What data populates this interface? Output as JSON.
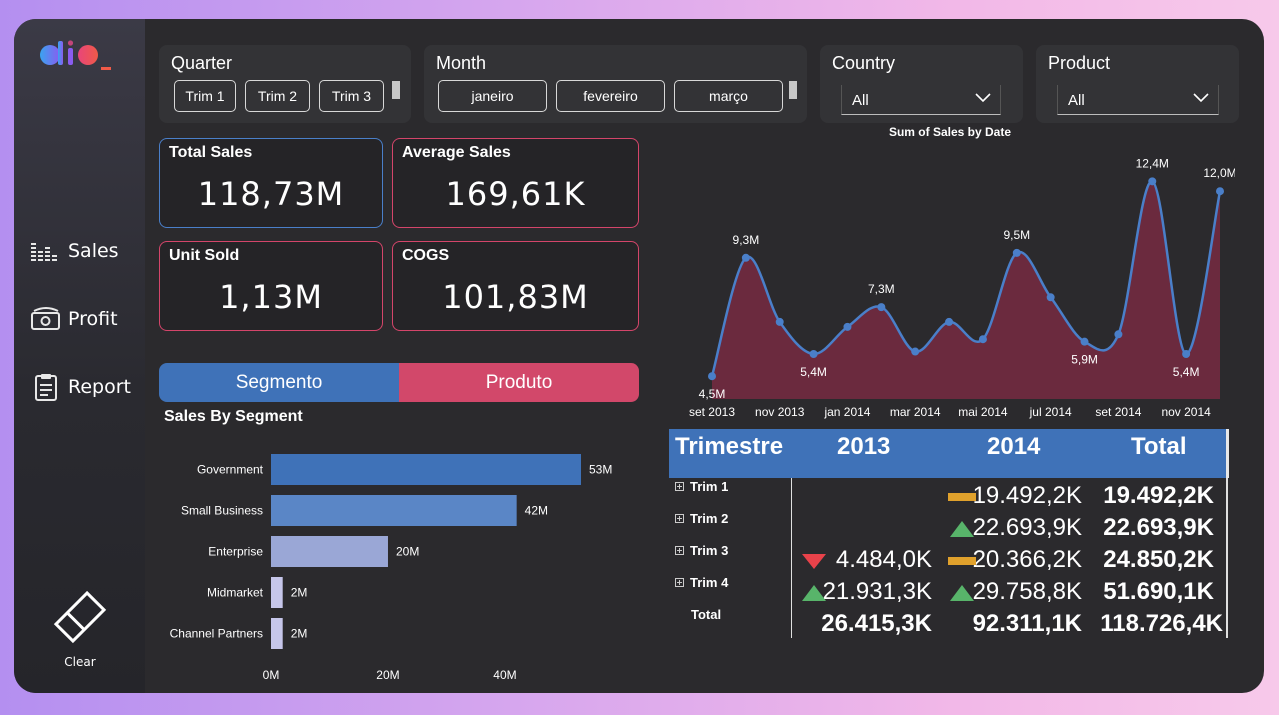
{
  "sidebar": {
    "nav": [
      {
        "label": "Sales",
        "icon": "sales-bars-icon"
      },
      {
        "label": "Profit",
        "icon": "money-icon"
      },
      {
        "label": "Report",
        "icon": "clipboard-icon"
      }
    ],
    "clear_label": "Clear"
  },
  "slicers": {
    "quarter": {
      "title": "Quarter",
      "options": [
        "Trim 1",
        "Trim 2",
        "Trim 3"
      ]
    },
    "month": {
      "title": "Month",
      "options": [
        "janeiro",
        "fevereiro",
        "março"
      ]
    },
    "country": {
      "title": "Country",
      "value": "All"
    },
    "product": {
      "title": "Product",
      "value": "All"
    }
  },
  "cards": {
    "total_sales": {
      "title": "Total Sales",
      "value": "118,73M"
    },
    "average_sales": {
      "title": "Average Sales",
      "value": "169,61K"
    },
    "unit_sold": {
      "title": "Unit Sold",
      "value": "1,13M"
    },
    "cogs": {
      "title": "COGS",
      "value": "101,83M"
    }
  },
  "toggle": {
    "left": "Segmento",
    "right": "Produto"
  },
  "colors": {
    "accent_blue": "#3f72b8",
    "accent_pink": "#d2486a",
    "area_fill": "#6b2a3e",
    "line": "#4a7fc9"
  },
  "chart_data": [
    {
      "type": "bar",
      "title": "Sales By Segment",
      "orientation": "horizontal",
      "categories": [
        "Government",
        "Small Business",
        "Enterprise",
        "Midmarket",
        "Channel Partners"
      ],
      "values": [
        53,
        42,
        20,
        2,
        2
      ],
      "value_labels": [
        "53M",
        "42M",
        "20M",
        "2M",
        "2M"
      ],
      "xticks": [
        "0M",
        "20M",
        "40M"
      ],
      "xlim": [
        0,
        60
      ],
      "bar_colors": [
        "#3f72b8",
        "#5a86c6",
        "#9aa7d6",
        "#c6c6ea",
        "#c6c6ea"
      ]
    },
    {
      "type": "area",
      "title": "Sum of Sales by Date",
      "x": [
        "set 2013",
        "out 2013",
        "nov 2013",
        "dez 2013",
        "jan 2014",
        "fev 2014",
        "mar 2014",
        "abr 2014",
        "mai 2014",
        "jun 2014",
        "jul 2014",
        "ago 2014",
        "set 2014",
        "out 2014",
        "nov 2014",
        "dez 2014"
      ],
      "values": [
        4.5,
        9.3,
        6.7,
        5.4,
        6.5,
        7.3,
        5.5,
        6.7,
        6.0,
        9.5,
        7.7,
        5.9,
        6.2,
        12.4,
        5.4,
        12.0
      ],
      "point_labels": [
        {
          "i": 0,
          "text": "4,5M"
        },
        {
          "i": 1,
          "text": "9,3M"
        },
        {
          "i": 3,
          "text": "5,4M"
        },
        {
          "i": 5,
          "text": "7,3M"
        },
        {
          "i": 9,
          "text": "9,5M"
        },
        {
          "i": 11,
          "text": "5,9M"
        },
        {
          "i": 13,
          "text": "12,4M"
        },
        {
          "i": 14,
          "text": "5,4M"
        },
        {
          "i": 15,
          "text": "12,0M"
        }
      ],
      "xticks": [
        "set 2013",
        "nov 2013",
        "jan 2014",
        "mar 2014",
        "mai 2014",
        "jul 2014",
        "set 2014",
        "nov 2014"
      ],
      "ylim": [
        4,
        13
      ]
    }
  ],
  "matrix": {
    "headers": [
      "Trimestre",
      "2013",
      "2014",
      "Total"
    ],
    "rows": [
      {
        "label": "Trim 1",
        "y2013": "",
        "ind2013": "",
        "y2014": "19.492,2K",
        "ind2014": "flat",
        "total": "19.492,2K"
      },
      {
        "label": "Trim 2",
        "y2013": "",
        "ind2013": "",
        "y2014": "22.693,9K",
        "ind2014": "up",
        "total": "22.693,9K"
      },
      {
        "label": "Trim 3",
        "y2013": "4.484,0K",
        "ind2013": "down",
        "y2014": "20.366,2K",
        "ind2014": "flat",
        "total": "24.850,2K"
      },
      {
        "label": "Trim 4",
        "y2013": "21.931,3K",
        "ind2013": "up",
        "y2014": "29.758,8K",
        "ind2014": "up",
        "total": "51.690,1K"
      }
    ],
    "total_row": {
      "label": "Total",
      "y2013": "26.415,3K",
      "y2014": "92.311,1K",
      "total": "118.726,4K"
    }
  }
}
